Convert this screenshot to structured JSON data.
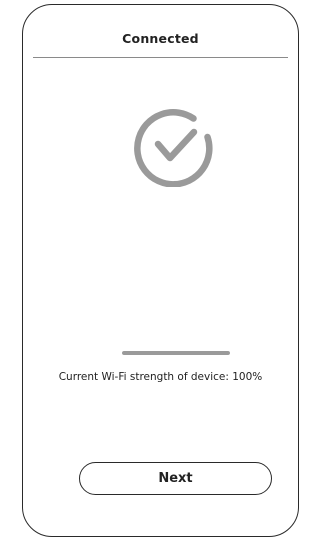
{
  "header": {
    "title": "Connected"
  },
  "status": {
    "icon": "check-circle-icon",
    "icon_color": "#9a9a9a",
    "wifi_strength_percent": 100,
    "wifi_text": "Current Wi-Fi strength of device: 100%"
  },
  "actions": {
    "next_label": "Next"
  },
  "colors": {
    "frame": "#2a2a2a",
    "divider": "#8a8a8a",
    "accent_gray": "#9a9a9a"
  }
}
